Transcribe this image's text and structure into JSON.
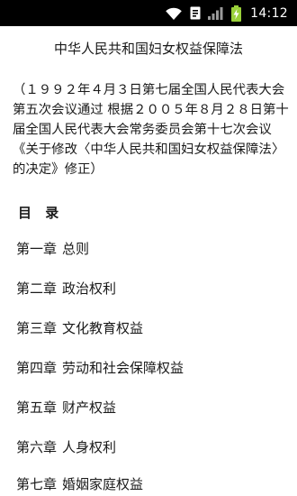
{
  "status_bar": {
    "time": "14:12",
    "icons": [
      "wifi-icon",
      "notification-icon",
      "signal-icon",
      "battery-charging-icon"
    ]
  },
  "document": {
    "title": "中华人民共和国妇女权益保障法",
    "note": "（１９９２年４月３日第七届全国人民代表大会第五次会议通过 根据２００５年８月２８日第十届全国人民代表大会常务委员会第十七次会议《关于修改〈中华人民共和国妇女权益保障法〉的决定》修正）",
    "toc_heading": "目 录",
    "toc": [
      {
        "chapter": "第一章",
        "name": "总则"
      },
      {
        "chapter": "第二章",
        "name": "政治权利"
      },
      {
        "chapter": "第三章",
        "name": "文化教育权益"
      },
      {
        "chapter": "第四章",
        "name": "劳动和社会保障权益"
      },
      {
        "chapter": "第五章",
        "name": "财产权益"
      },
      {
        "chapter": "第六章",
        "name": "人身权利"
      },
      {
        "chapter": "第七章",
        "name": "婚姻家庭权益"
      }
    ]
  }
}
